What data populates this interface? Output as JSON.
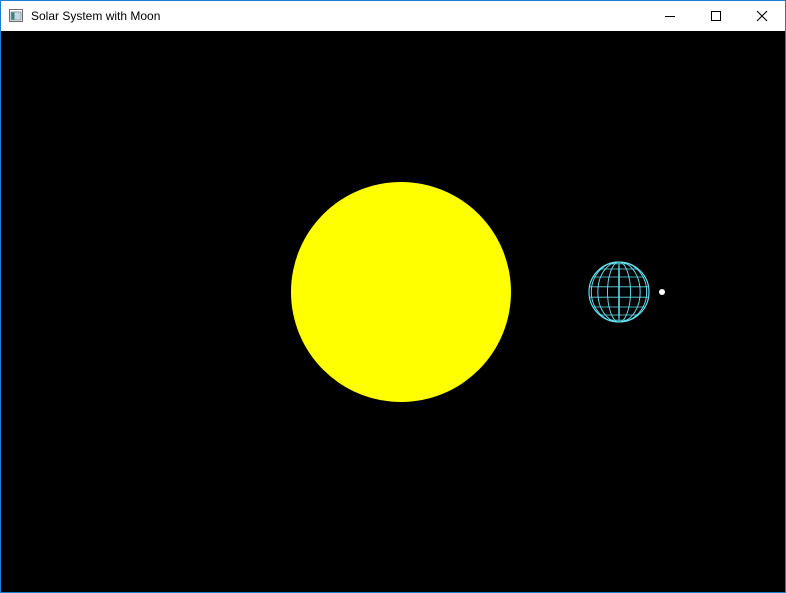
{
  "window": {
    "title": "Solar System with Moon",
    "controls": [
      "minimize-icon",
      "maximize-icon",
      "close-icon"
    ],
    "border_color": "#1a7fd4"
  },
  "scene": {
    "background_color": "#000000",
    "sun": {
      "color": "#ffff00"
    },
    "planet": {
      "color": "#66ddee",
      "render_style": "wireframe"
    },
    "moon": {
      "color": "#ffffff"
    }
  }
}
